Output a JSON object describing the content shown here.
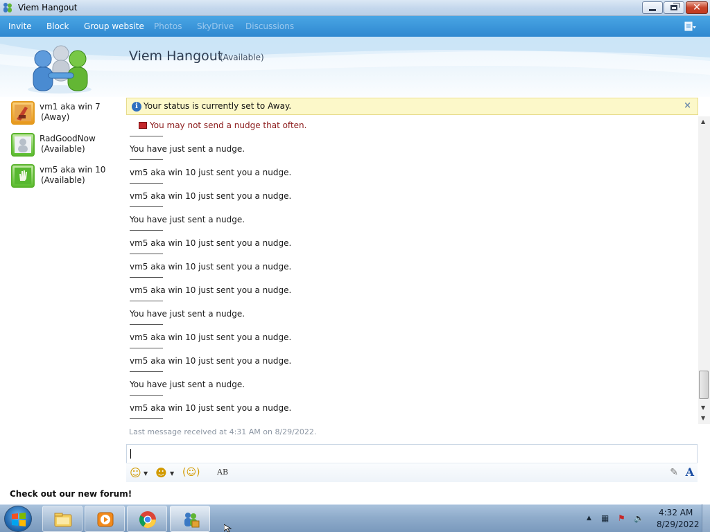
{
  "window": {
    "title": "Viem Hangout",
    "caption": {
      "min": "minimize",
      "max": "restore",
      "close": "close"
    }
  },
  "menu": {
    "items": [
      {
        "label": "Invite",
        "enabled": true
      },
      {
        "label": "Block",
        "enabled": true
      },
      {
        "label": "Group website",
        "enabled": true
      },
      {
        "label": "Photos",
        "enabled": false
      },
      {
        "label": "SkyDrive",
        "enabled": false
      },
      {
        "label": "Discussions",
        "enabled": false
      }
    ],
    "options_icon": "options-menu-icon"
  },
  "header": {
    "title": "Viem Hangout",
    "status": "(Available)"
  },
  "contacts": [
    {
      "name": "vm1 aka win 7",
      "status": "(Away)",
      "state": "away"
    },
    {
      "name": "RadGoodNow",
      "status": "(Available)",
      "state": "available"
    },
    {
      "name": "vm5 aka win 10",
      "status": "(Available)",
      "state": "available"
    }
  ],
  "sidebar": {
    "forum_link": "Check out our new forum!"
  },
  "infobar": {
    "text": "Your status is currently set to Away.",
    "close": "×"
  },
  "conversation": {
    "warning": "You may not send a nudge that often.",
    "messages": [
      "You have just sent a nudge.",
      "vm5 aka win 10 just sent you a nudge.",
      "vm5 aka win 10 just sent you a nudge.",
      "You have just sent a nudge.",
      "vm5 aka win 10 just sent you a nudge.",
      "vm5 aka win 10 just sent you a nudge.",
      "vm5 aka win 10 just sent you a nudge.",
      "You have just sent a nudge.",
      "vm5 aka win 10 just sent you a nudge.",
      "vm5 aka win 10 just sent you a nudge.",
      "You have just sent a nudge.",
      "vm5 aka win 10 just sent you a nudge."
    ],
    "last_message": "Last message received at 4:31 AM on 8/29/2022."
  },
  "compose": {
    "value": "",
    "tools": [
      "emoticon-icon",
      "wink-icon",
      "nudge-icon",
      "spellcheck-icon"
    ],
    "spell_label": "AB",
    "font_label": "A"
  },
  "taskbar": {
    "apps": [
      "explorer-icon",
      "media-player-icon",
      "chrome-icon",
      "messenger-icon"
    ],
    "clock_time": "4:32 AM",
    "clock_date": "8/29/2022"
  },
  "colors": {
    "menu_blue": "#2f88d0",
    "away": "#e8971a",
    "available": "#5bbd2e",
    "warning_text": "#8b1a1a"
  }
}
